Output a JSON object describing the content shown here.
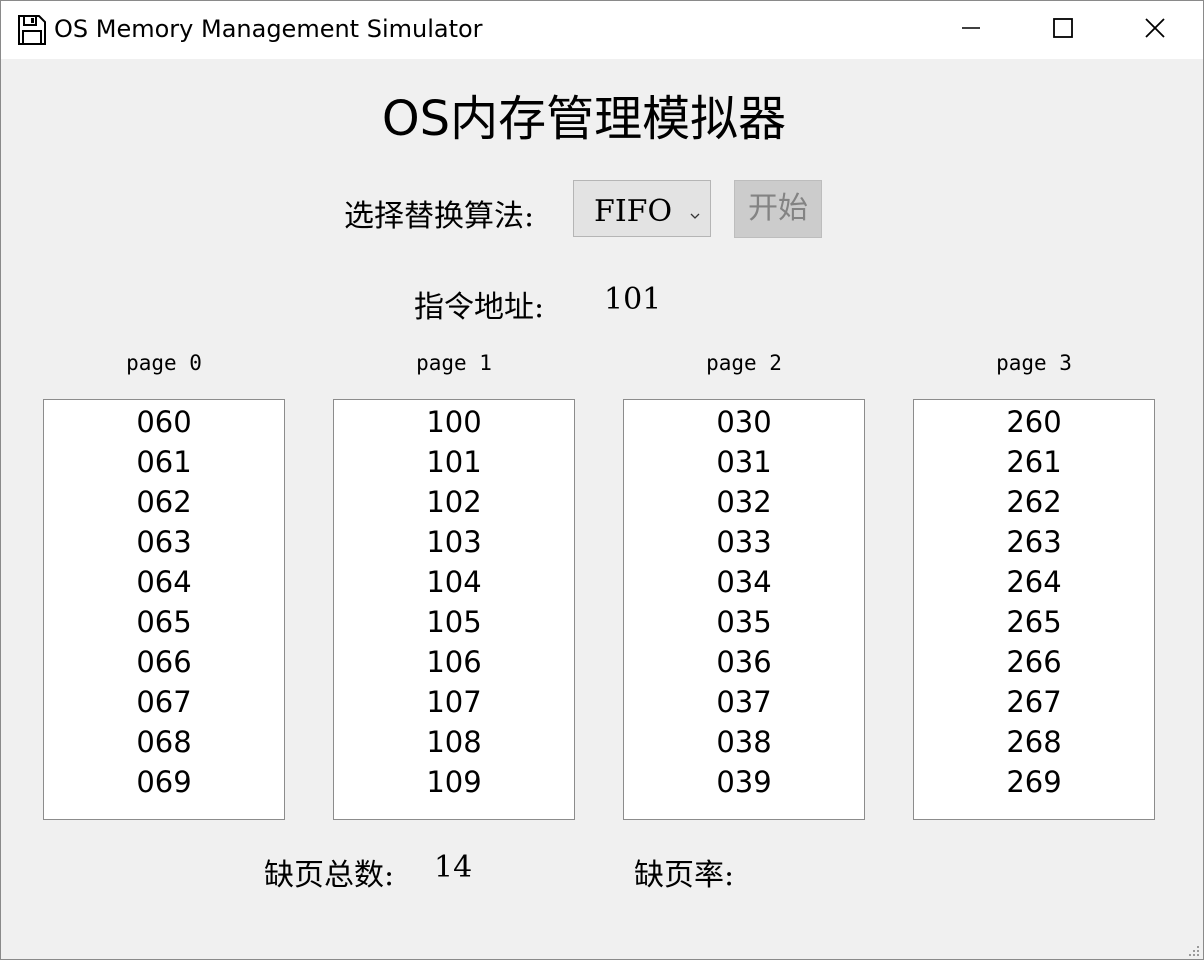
{
  "window": {
    "title": "OS Memory Management Simulator"
  },
  "heading": "OS内存管理模拟器",
  "controls": {
    "algorithm_label": "选择替换算法:",
    "algorithm_selected": "FIFO",
    "start_label": "开始"
  },
  "instruction": {
    "label": "指令地址:",
    "value": "101"
  },
  "pages": [
    {
      "title": "page 0",
      "entries": [
        "060",
        "061",
        "062",
        "063",
        "064",
        "065",
        "066",
        "067",
        "068",
        "069"
      ]
    },
    {
      "title": "page 1",
      "entries": [
        "100",
        "101",
        "102",
        "103",
        "104",
        "105",
        "106",
        "107",
        "108",
        "109"
      ]
    },
    {
      "title": "page 2",
      "entries": [
        "030",
        "031",
        "032",
        "033",
        "034",
        "035",
        "036",
        "037",
        "038",
        "039"
      ]
    },
    {
      "title": "page 3",
      "entries": [
        "260",
        "261",
        "262",
        "263",
        "264",
        "265",
        "266",
        "267",
        "268",
        "269"
      ]
    }
  ],
  "stats": {
    "fault_count_label": "缺页总数:",
    "fault_count_value": "14",
    "fault_rate_label": "缺页率:",
    "fault_rate_value": ""
  },
  "icons": {
    "app": "floppy-disk-icon",
    "minimize": "minimize-icon",
    "maximize": "maximize-icon",
    "close": "close-icon"
  }
}
